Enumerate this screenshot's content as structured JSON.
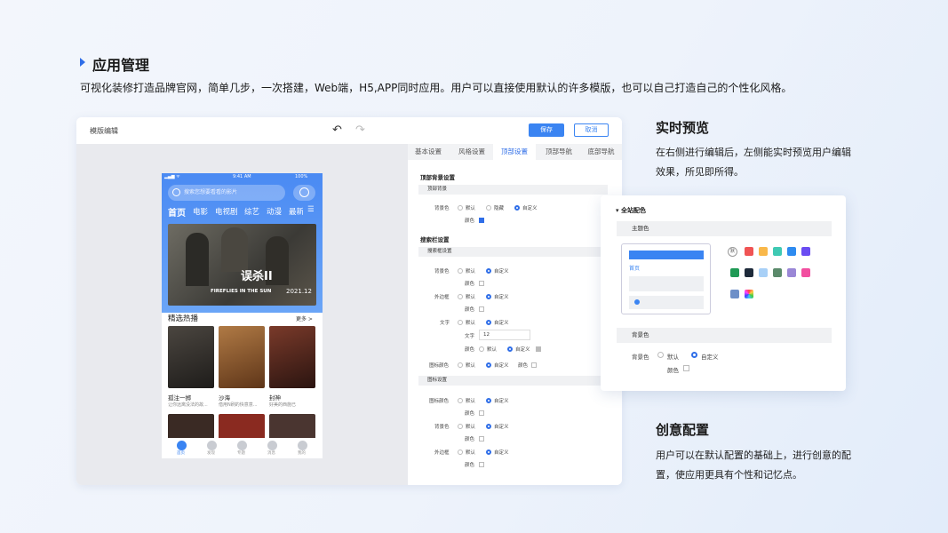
{
  "heading": {
    "title": "应用管理",
    "desc": "可视化装修打造品牌官网，简单几步，一次搭建，Web端，H5,APP同时应用。用户可以直接使用默认的许多模版，也可以自己打造自己的个性化风格。"
  },
  "editor": {
    "title": "模版编辑",
    "save": "保存",
    "cancel": "取消",
    "tabs": [
      "基本设置",
      "风格设置",
      "顶部设置",
      "顶部导航",
      "底部导航"
    ],
    "panel": {
      "sec1": "顶部背景设置",
      "sub1": "顶部背景",
      "bg_label": "背景色",
      "opts": [
        "默认",
        "隐藏",
        "自定义"
      ],
      "color_label": "颜色",
      "sec2": "搜索栏设置",
      "sub2": "搜索框设置",
      "r_bg": "背景色",
      "r_border": "外边框",
      "r_text": "文字",
      "text_label": "文字",
      "text_value": "12",
      "r_iconcolor": "图标颜色",
      "opt_default": "默认",
      "opt_custom": "自定义",
      "sub3": "图标设置"
    }
  },
  "phone": {
    "time": "9:41 AM",
    "battery": "100%",
    "search_placeholder": "搜索您想要看看的影片",
    "cats": [
      "首页",
      "电影",
      "电视剧",
      "综艺",
      "动漫",
      "最新"
    ],
    "banner_title": "误杀II",
    "banner_en": "FIREFLIES IN THE SUN",
    "banner_date": "2021.12",
    "section": "精选热播",
    "more": "更多 >",
    "items": [
      {
        "title": "孤注一掷",
        "sub": "让你远离没法的故..."
      },
      {
        "title": "沙海",
        "sub": "借用N刷的快意意..."
      },
      {
        "title": "封神",
        "sub": "好美的西施已"
      }
    ],
    "nav": [
      "首页",
      "发现",
      "专题",
      "消息",
      "我的"
    ]
  },
  "right": {
    "t1": "实时预览",
    "p1": "在右侧进行编辑后，左侧能实时预览用户编辑效果，所见即所得。",
    "t2": "创意配置",
    "p2": "用户可以在默认配置的基础上，进行创意的配置，使应用更具有个性和记忆点。"
  },
  "popover": {
    "title": "全站配色",
    "theme": "主题色",
    "preview_tab": "首页",
    "default_swatch": "默",
    "bg_bar": "背景色",
    "bg_label": "背景色",
    "opt_default": "默认",
    "opt_custom": "自定义",
    "color_label": "颜色"
  },
  "colors": {
    "accent": "#2f6ee8",
    "theme_swatches": [
      "#f05454",
      "#f9b84a",
      "#3fc9b3",
      "#2e8bf0",
      "#6a4cf2",
      "#1f9a55",
      "#1e2a3a",
      "#a8d0f7",
      "#5b8a6b",
      "#9a87d6",
      "#f24fa0",
      "#6d8fc8"
    ]
  }
}
